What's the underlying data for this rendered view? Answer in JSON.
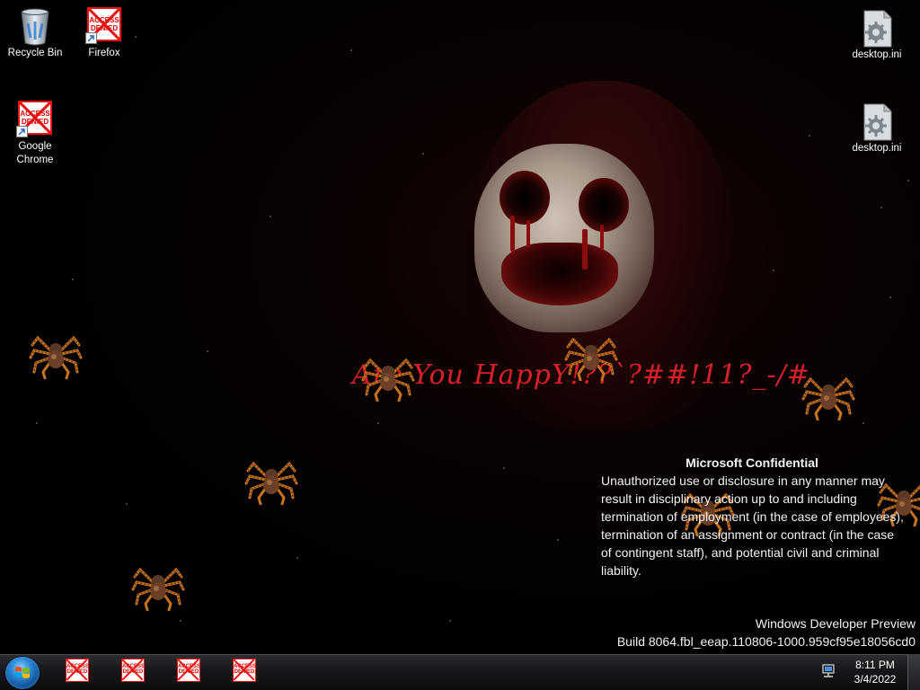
{
  "desktop": {
    "icons": [
      {
        "label": "Recycle Bin",
        "icon": "recycle-bin-icon"
      },
      {
        "label": "Firefox",
        "icon": "access-denied-icon",
        "badge": "ACCESS DENIED"
      },
      {
        "label": "Google Chrome",
        "icon": "access-denied-icon",
        "badge": "ACCESS DENIED"
      },
      {
        "label": "desktop.ini",
        "icon": "settings-file-icon"
      },
      {
        "label": "desktop.ini",
        "icon": "settings-file-icon"
      }
    ]
  },
  "wallpaper": {
    "taunt": "Are You HappY!??`?##!11?_-/#",
    "taunt_color": "#d8202a"
  },
  "watermark": {
    "heading": "Microsoft Confidential",
    "body": "Unauthorized use or disclosure in any manner may result in disciplinary action up to and including termination of employment (in the case of employees), termination of an assignment or contract (in the case of contingent staff), and potential civil and criminal liability.",
    "product": "Windows Developer Preview",
    "build": "Build 8064.fbl_eeap.110806-1000.959cf95e18056cd0"
  },
  "taskbar": {
    "start_icon": "windows-start-orb",
    "pinned": [
      {
        "badge": "ACCESS DENIED",
        "icon": "access-denied-icon"
      },
      {
        "badge": "ACCESS DENIED",
        "icon": "access-denied-icon"
      },
      {
        "badge": "ACCESS DENIED",
        "icon": "access-denied-icon"
      },
      {
        "badge": "ACCESS DENIED",
        "icon": "access-denied-icon"
      }
    ],
    "tray_icon": "network-icon",
    "time": "8:11 PM",
    "date": "3/4/2022"
  },
  "colors": {
    "access_denied_red": "#e11111",
    "taskbar_bg": "#15171a"
  }
}
